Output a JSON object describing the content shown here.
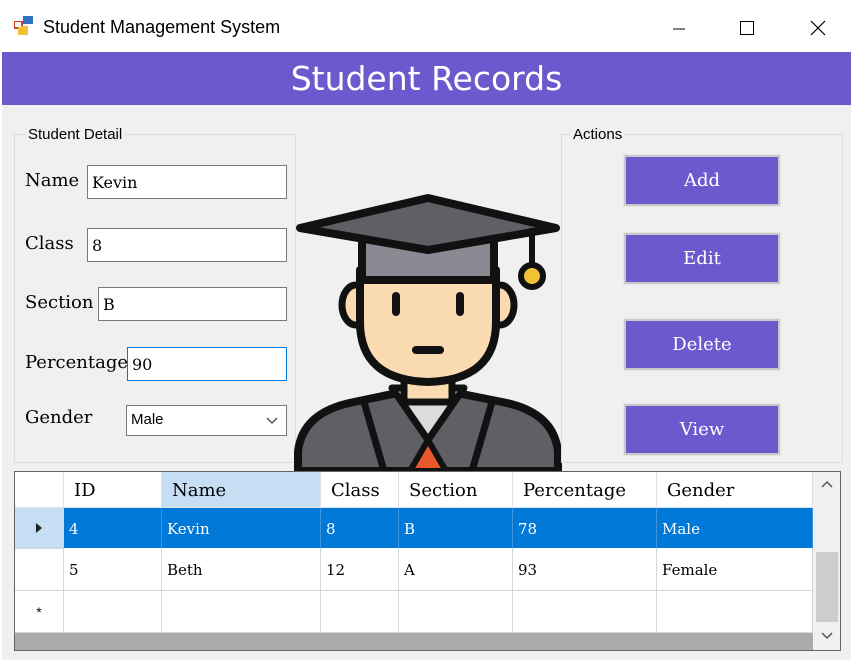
{
  "window": {
    "title": "Student Management System"
  },
  "header": {
    "title": "Student Records"
  },
  "student_detail": {
    "legend": "Student Detail",
    "name_label": "Name",
    "name_value": "Kevin",
    "class_label": "Class",
    "class_value": "8",
    "section_label": "Section",
    "section_value": "B",
    "percentage_label": "Percentage",
    "percentage_value": "90",
    "gender_label": "Gender",
    "gender_value": "Male"
  },
  "actions": {
    "legend": "Actions",
    "add_label": "Add",
    "edit_label": "Edit",
    "delete_label": "Delete",
    "view_label": "View"
  },
  "grid": {
    "columns": [
      "ID",
      "Name",
      "Class",
      "Section",
      "Percentage",
      "Gender"
    ],
    "rows": [
      [
        "4",
        "Kevin",
        "8",
        "B",
        "78",
        "Male"
      ],
      [
        "5",
        "Beth",
        "12",
        "A",
        "93",
        "Female"
      ]
    ],
    "new_row_marker": "*"
  },
  "colors": {
    "accent": "#6a5acd",
    "selection": "#0078d7",
    "header_selected": "#c6def4"
  }
}
